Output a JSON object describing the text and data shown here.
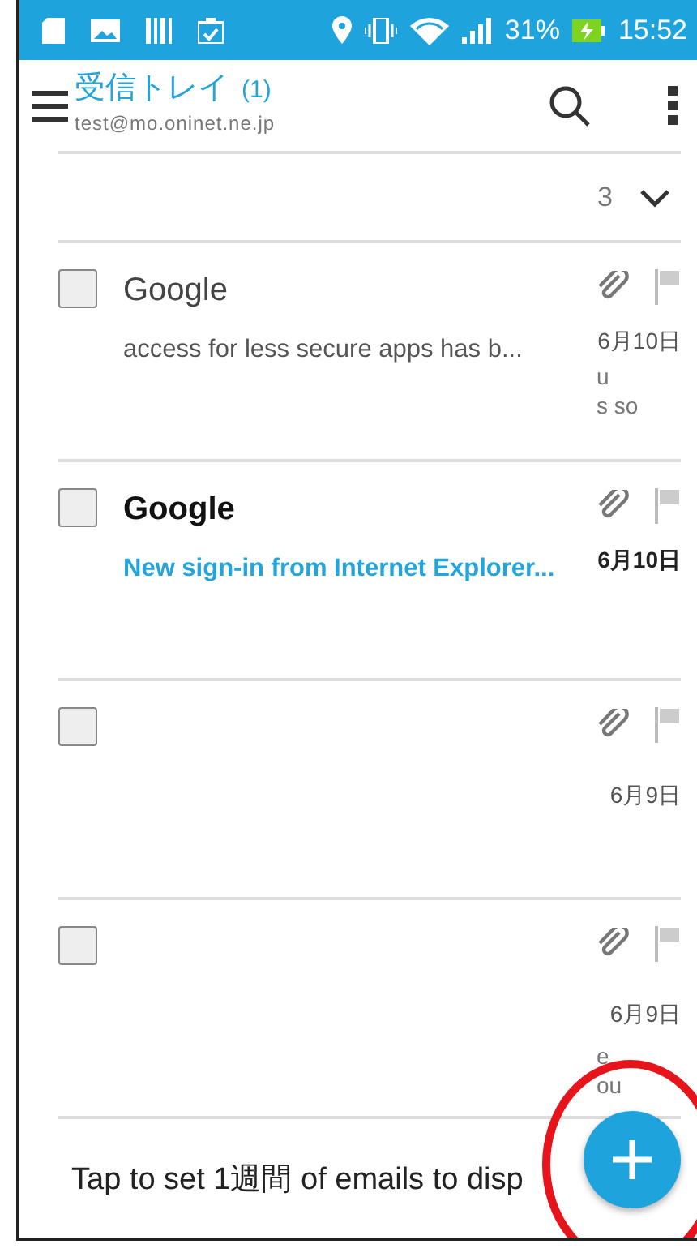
{
  "status_bar": {
    "battery": "31%",
    "time": "15:52"
  },
  "app_bar": {
    "title": "受信トレイ",
    "count": "(1)",
    "account": "test@mo.oninet.ne.jp"
  },
  "thread_header": {
    "count": "3",
    "expanded": false
  },
  "messages": [
    {
      "sender": "Google",
      "subject": "access for less secure apps has b...",
      "date": "6月10日",
      "unread": false,
      "checked": false,
      "attachment": true,
      "flagged": false,
      "fragments": [
        "u",
        "s so"
      ]
    },
    {
      "sender": "Google",
      "subject": "New sign-in from Internet Explorer...",
      "date": "6月10日",
      "unread": true,
      "checked": false,
      "attachment": true,
      "flagged": false
    },
    {
      "date": "6月9日",
      "unread": false,
      "checked": false,
      "attachment": true,
      "flagged": false
    },
    {
      "date": "6月9日",
      "unread": false,
      "checked": false,
      "attachment": true,
      "flagged": false,
      "fragments": [
        "e",
        "ou"
      ]
    }
  ],
  "footer": {
    "text": "Tap to set 1週間 of emails to disp"
  }
}
